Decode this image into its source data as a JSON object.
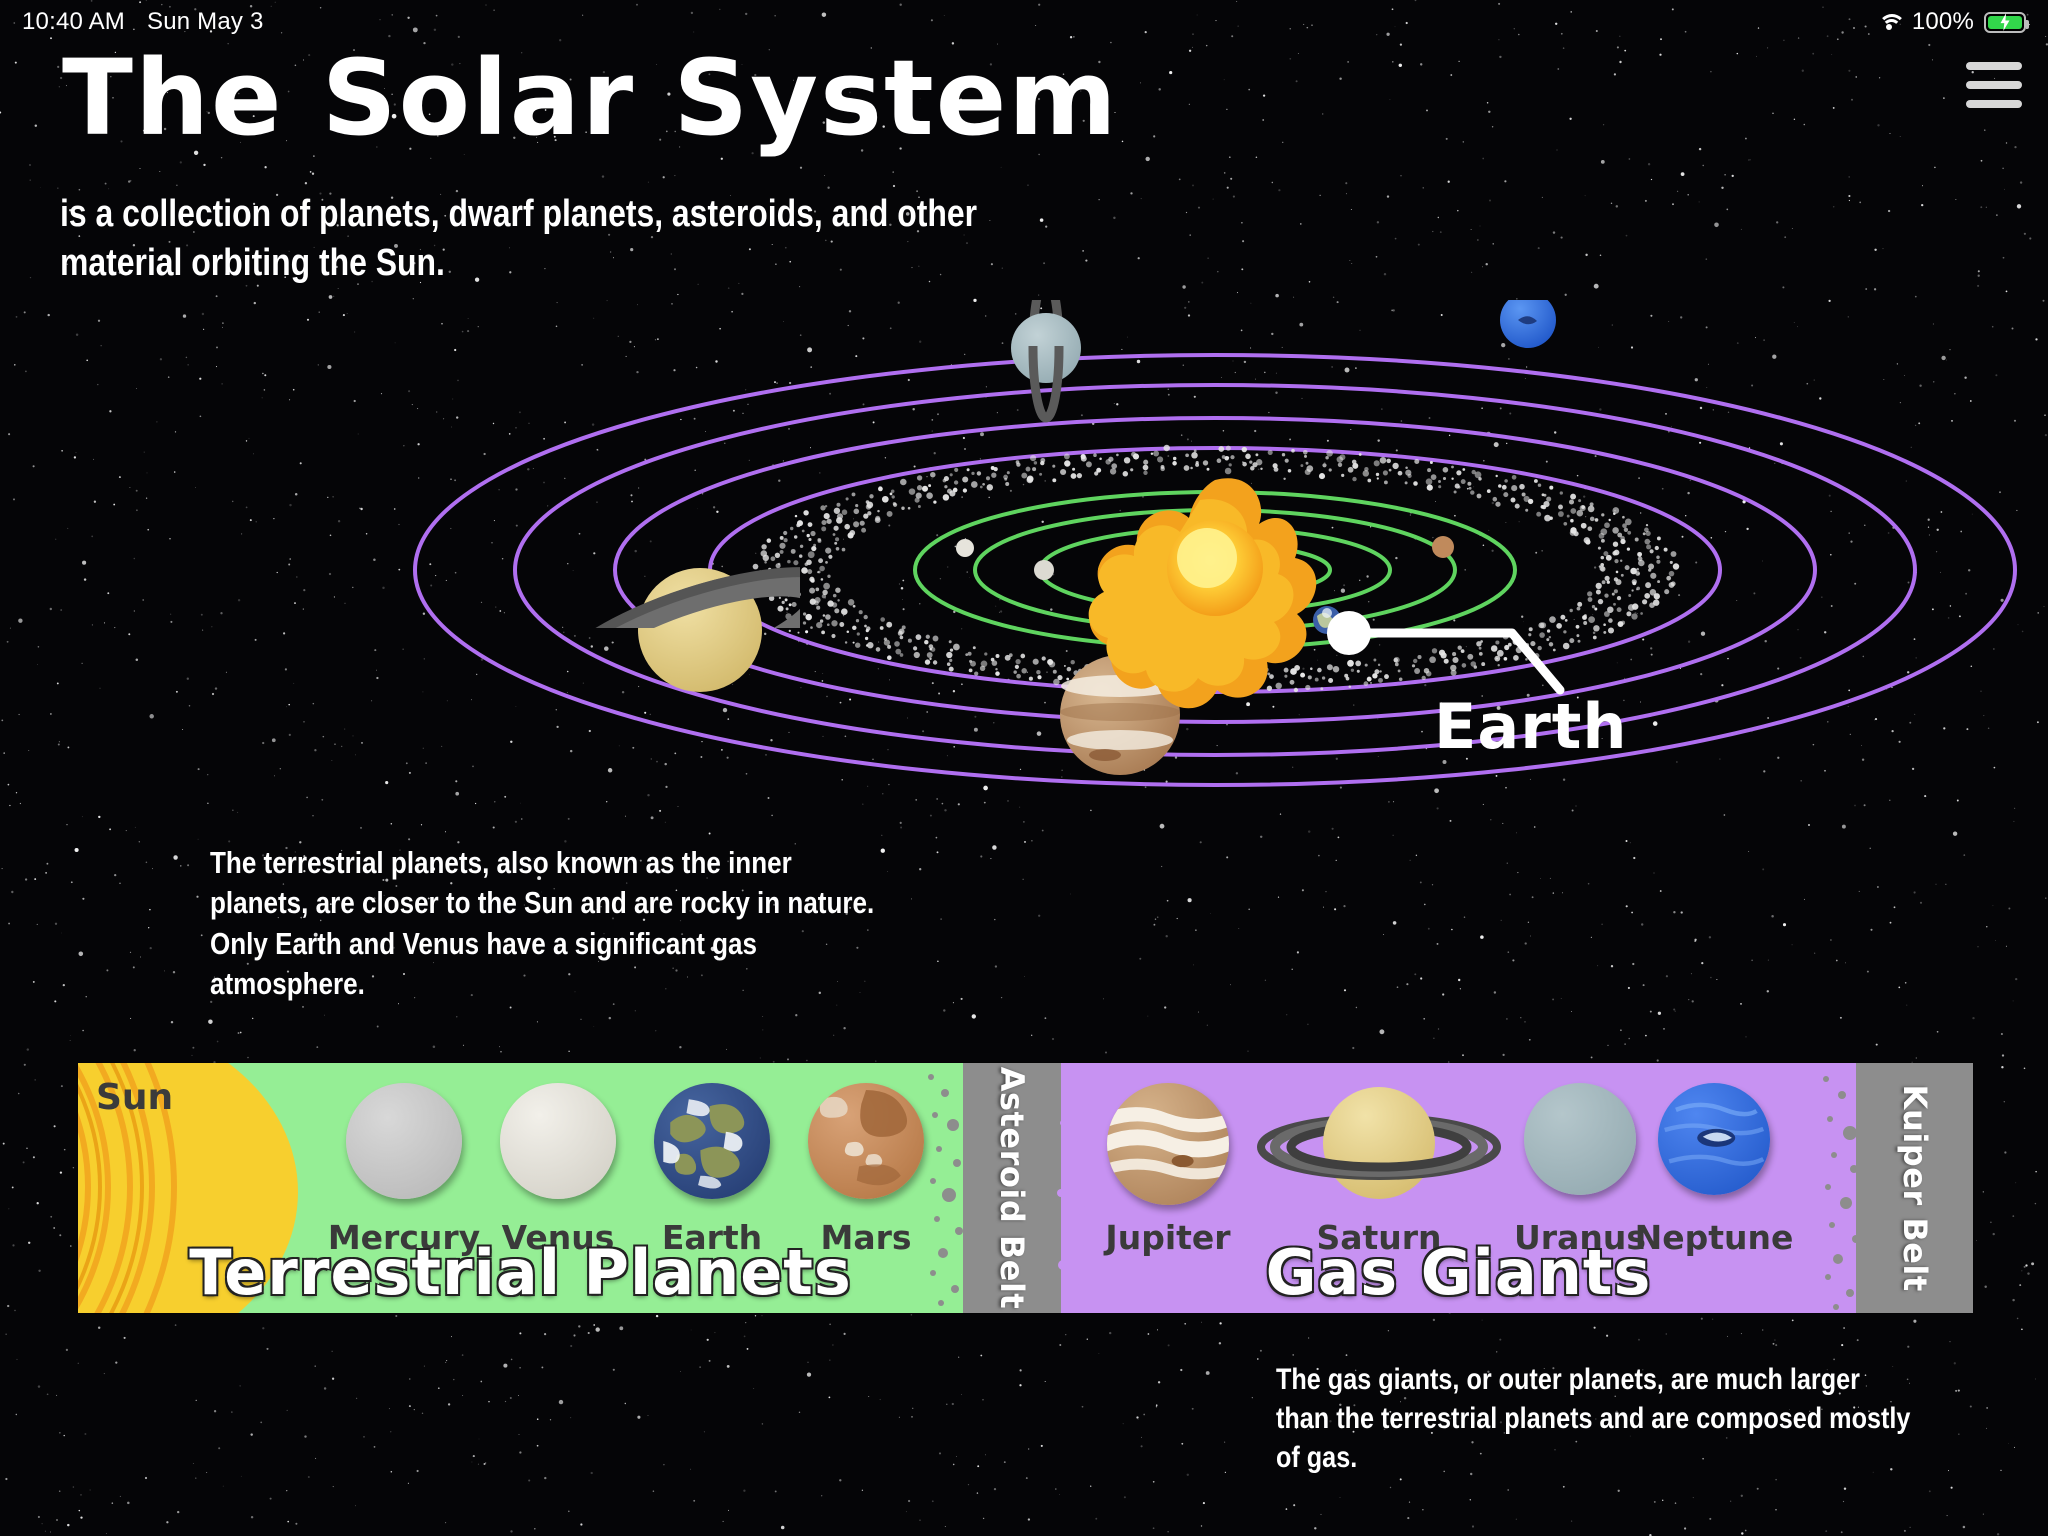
{
  "status_bar": {
    "time": "10:40 AM",
    "date": "Sun May 3",
    "battery_percent": "100%",
    "wifi_icon": "wifi-icon",
    "battery_icon": "battery-charging-icon"
  },
  "menu": {
    "icon": "hamburger-menu-icon"
  },
  "header": {
    "title": "The Solar System",
    "subtitle": "is a collection of planets, dwarf planets, asteroids, and other material orbiting the Sun."
  },
  "diagram": {
    "callout_label": "Earth",
    "inner_orbit_color": "#5FD45F",
    "outer_orbit_color": "#B06FF0",
    "asteroid_belt_color": "#DCDCDC",
    "sun_color": "#F5A623",
    "bodies": [
      {
        "name": "Sun",
        "color": "#FFD34D"
      },
      {
        "name": "Mercury",
        "color": "#BFBFBF"
      },
      {
        "name": "Venus",
        "color": "#E0DED6"
      },
      {
        "name": "Earth",
        "color": "#3B5FA8"
      },
      {
        "name": "Mars",
        "color": "#C08050"
      },
      {
        "name": "Jupiter",
        "color": "#C59A72"
      },
      {
        "name": "Saturn",
        "color": "#E5D18C"
      },
      {
        "name": "Uranus",
        "color": "#A8BEC4"
      },
      {
        "name": "Neptune",
        "color": "#2F6FE0"
      }
    ]
  },
  "notes": {
    "terrestrial": "The terrestrial planets, also known as the inner planets, are closer to the Sun and are rocky in nature.  Only Earth and Venus have a significant gas atmosphere.",
    "gas_giants": "The gas giants, or outer planets, are much larger than the terrestrial planets and are composed mostly of gas."
  },
  "band": {
    "sun_label": "Sun",
    "terrestrial_category": "Terrestrial Planets",
    "gas_category": "Gas Giants",
    "asteroid_belt_label": "Asteroid Belt",
    "kuiper_belt_label": "Kuiper Belt",
    "terrestrial_color": "#95EE95",
    "gas_color": "#C792F2",
    "belt_color": "#8D8D8D",
    "terrestrial_planets": [
      {
        "name": "Mercury",
        "color": "#C4C4C4"
      },
      {
        "name": "Venus",
        "color": "#DEDCD6"
      },
      {
        "name": "Earth",
        "color": "#2F4F8F"
      },
      {
        "name": "Mars",
        "color": "#C68A61"
      }
    ],
    "gas_planets": [
      {
        "name": "Jupiter",
        "color": "#C79C74"
      },
      {
        "name": "Saturn",
        "color": "#E3CE87"
      },
      {
        "name": "Uranus",
        "color": "#9FB4BA"
      },
      {
        "name": "Neptune",
        "color": "#2F6FE0"
      }
    ]
  }
}
